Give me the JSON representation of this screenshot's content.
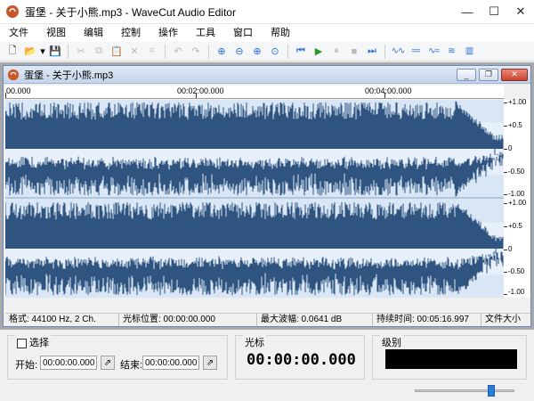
{
  "window": {
    "title": "蛋堡 - 关于小熊.mp3 - WaveCut Audio Editor",
    "minimize": "—",
    "maximize": "☐",
    "close": "✕"
  },
  "menu": [
    "文件",
    "视图",
    "编辑",
    "控制",
    "操作",
    "工具",
    "窗口",
    "帮助"
  ],
  "toolbar": {
    "new": "🗋",
    "open": "📂",
    "open_dropdown": "▾",
    "save": "💾",
    "cut": "✂",
    "copy": "⧉",
    "paste": "📋",
    "delete": "✕",
    "crop": "⌗",
    "undo": "↶",
    "redo": "↷",
    "zoom_in": "⊕",
    "zoom_out": "⊖",
    "zoom_selection": "⊕",
    "zoom_all": "⊙",
    "go_start": "⏮",
    "play": "▶",
    "pause": "⏸",
    "stop": "■",
    "go_end": "⏭",
    "wave_tools": [
      "∿∿",
      "≈≈",
      "∿≈",
      "≋",
      "▥"
    ]
  },
  "document": {
    "title": "蛋堡 - 关于小熊.mp3",
    "minimize": "_",
    "restore": "❐",
    "close": "✕"
  },
  "ruler": {
    "labels": [
      "00.000",
      "00:02:00.000",
      "00:04:00.000"
    ]
  },
  "scale": {
    "top": [
      "+1.00",
      "+0.5",
      "0",
      "-0.50",
      "-1.00"
    ],
    "bottom": [
      "+1.00",
      "+0.5",
      "0",
      "-0.50",
      "-1.00"
    ]
  },
  "status": {
    "format": "格式: 44100 Hz, 2 Ch.",
    "cursor_pos": "光标位置: 00:00:00.000",
    "max_amp": "最大波幅: 0.0641 dB",
    "duration": "持续时间: 00:05:16.997",
    "file_size": "文件大小"
  },
  "selection": {
    "checkbox_label": "选择",
    "start_label": "开始:",
    "start_value": "00:00:00.000",
    "end_label": "结束:",
    "end_value": "00:00:00.000",
    "pin_icon": "⇗"
  },
  "cursor_panel": {
    "label": "光标",
    "value": "00:00:00.000"
  },
  "level_panel": {
    "label": "级别"
  },
  "colors": {
    "wave": "#2f5480",
    "wave_bg": "#d8e6f5",
    "accent": "#2a7cd6"
  }
}
